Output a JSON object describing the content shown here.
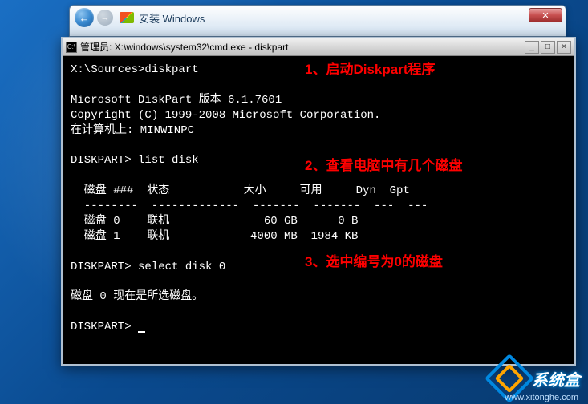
{
  "installer": {
    "title": "安装 Windows"
  },
  "cmd": {
    "title": "管理员: X:\\windows\\system32\\cmd.exe - diskpart",
    "icon_label": "C:\\",
    "lines": {
      "prompt1": "X:\\Sources>diskpart",
      "version": "Microsoft DiskPart 版本 6.1.7601",
      "copyright": "Copyright (C) 1999-2008 Microsoft Corporation.",
      "computer": "在计算机上: MINWINPC",
      "prompt2": "DISKPART> list disk",
      "header": "  磁盘 ###  状态           大小     可用     Dyn  Gpt",
      "divider": "  --------  -------------  -------  -------  ---  ---",
      "disk0": "  磁盘 0    联机              60 GB      0 B",
      "disk1": "  磁盘 1    联机            4000 MB  1984 KB",
      "prompt3": "DISKPART> select disk 0",
      "selected": "磁盘 0 现在是所选磁盘。",
      "prompt4": "DISKPART> "
    }
  },
  "annotations": {
    "a1": "1、启动Diskpart程序",
    "a2": "2、查看电脑中有几个磁盘",
    "a3": "3、选中编号为0的磁盘"
  },
  "watermark": {
    "brand": "系统盒",
    "url": "www.xitonghe.com"
  },
  "chart_data": {
    "type": "table",
    "title": "DISKPART list disk",
    "columns": [
      "磁盘 ###",
      "状态",
      "大小",
      "可用",
      "Dyn",
      "Gpt"
    ],
    "rows": [
      {
        "disk": "磁盘 0",
        "status": "联机",
        "size": "60 GB",
        "free": "0 B",
        "dyn": "",
        "gpt": ""
      },
      {
        "disk": "磁盘 1",
        "status": "联机",
        "size": "4000 MB",
        "free": "1984 KB",
        "dyn": "",
        "gpt": ""
      }
    ]
  }
}
